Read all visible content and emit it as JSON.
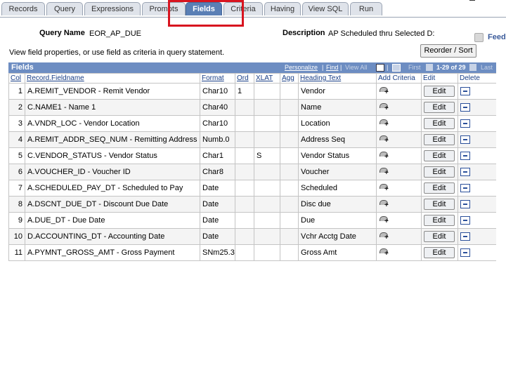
{
  "tabs": [
    {
      "label": "Records",
      "active": false
    },
    {
      "label": "Query",
      "active": false
    },
    {
      "label": "Expressions",
      "active": false
    },
    {
      "label": "Prompts",
      "active": false
    },
    {
      "label": "Fields",
      "active": true
    },
    {
      "label": "Criteria",
      "active": false
    },
    {
      "label": "Having",
      "active": false
    },
    {
      "label": "View SQL",
      "active": false
    },
    {
      "label": "Run",
      "active": false
    }
  ],
  "header": {
    "query_name_label": "Query Name",
    "query_name_value": "EOR_AP_DUE",
    "description_label": "Description",
    "description_value": "AP Scheduled thru Selected D:",
    "feed_label": "Feed",
    "instruction": "View field properties, or use field as criteria in query statement.",
    "reorder_label": "Reorder / Sort"
  },
  "grid": {
    "title": "Fields",
    "personalize": "Personalize",
    "find": "Find",
    "view_all": "View All",
    "first": "First",
    "range": "1-29 of 29",
    "last": "Last",
    "columns": [
      "Col",
      "Record.Fieldname",
      "Format",
      "Ord",
      "XLAT",
      "Agg",
      "Heading Text",
      "Add Criteria",
      "Edit",
      "Delete"
    ],
    "edit_label": "Edit",
    "rows": [
      {
        "col": "1",
        "field": "A.REMIT_VENDOR - Remit Vendor",
        "format": "Char10",
        "ord": "1",
        "xlat": "",
        "agg": "",
        "heading": "Vendor"
      },
      {
        "col": "2",
        "field": "C.NAME1 - Name 1",
        "format": "Char40",
        "ord": "",
        "xlat": "",
        "agg": "",
        "heading": "Name"
      },
      {
        "col": "3",
        "field": "A.VNDR_LOC - Vendor Location",
        "format": "Char10",
        "ord": "",
        "xlat": "",
        "agg": "",
        "heading": "Location"
      },
      {
        "col": "4",
        "field": "A.REMIT_ADDR_SEQ_NUM - Remitting Address",
        "format": "Numb.0",
        "ord": "",
        "xlat": "",
        "agg": "",
        "heading": "Address Seq"
      },
      {
        "col": "5",
        "field": "C.VENDOR_STATUS - Vendor Status",
        "format": "Char1",
        "ord": "",
        "xlat": "S",
        "agg": "",
        "heading": "Vendor Status"
      },
      {
        "col": "6",
        "field": "A.VOUCHER_ID - Voucher ID",
        "format": "Char8",
        "ord": "",
        "xlat": "",
        "agg": "",
        "heading": "Voucher"
      },
      {
        "col": "7",
        "field": "A.SCHEDULED_PAY_DT - Scheduled to Pay",
        "format": "Date",
        "ord": "",
        "xlat": "",
        "agg": "",
        "heading": "Scheduled"
      },
      {
        "col": "8",
        "field": "A.DSCNT_DUE_DT - Discount Due Date",
        "format": "Date",
        "ord": "",
        "xlat": "",
        "agg": "",
        "heading": "Disc due"
      },
      {
        "col": "9",
        "field": "A.DUE_DT - Due Date",
        "format": "Date",
        "ord": "",
        "xlat": "",
        "agg": "",
        "heading": "Due"
      },
      {
        "col": "10",
        "field": "D.ACCOUNTING_DT - Accounting Date",
        "format": "Date",
        "ord": "",
        "xlat": "",
        "agg": "",
        "heading": "Vchr Acctg Date"
      },
      {
        "col": "11",
        "field": "A.PYMNT_GROSS_AMT - Gross Payment",
        "format": "SNm25.3",
        "ord": "",
        "xlat": "",
        "agg": "",
        "heading": "Gross Amt"
      }
    ]
  },
  "colors": {
    "accent": "#6d8dc2",
    "active_tab": "#5a7fb5",
    "highlight": "#d8141f"
  }
}
